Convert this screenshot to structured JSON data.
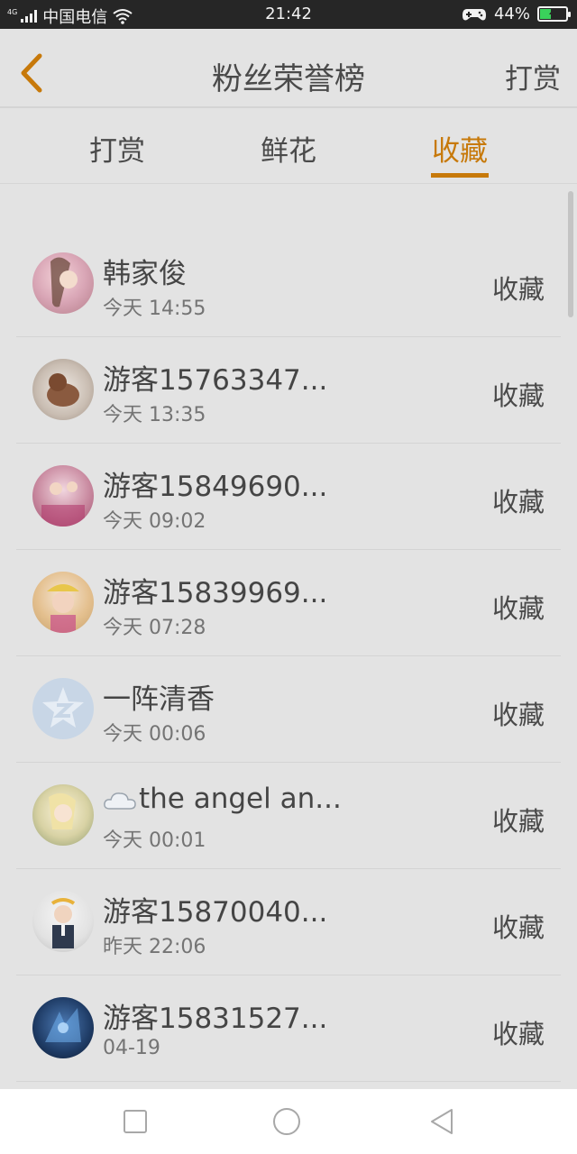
{
  "status_bar": {
    "network_label": "4G",
    "carrier": "中国电信",
    "time": "21:42",
    "battery_pct": "44%",
    "battery_level": 0.44,
    "icons": [
      "signal-icon",
      "wifi-icon",
      "game-controller-icon",
      "battery-icon"
    ]
  },
  "header": {
    "title": "粉丝荣誉榜",
    "action_label": "打赏",
    "back_icon": "chevron-left-icon",
    "accent_color": "#c7790a"
  },
  "tabs": [
    {
      "label": "打赏",
      "active": false
    },
    {
      "label": "鲜花",
      "active": false
    },
    {
      "label": "收藏",
      "active": true
    }
  ],
  "list": [
    {
      "name": "韩家俊",
      "time": "今天 14:55",
      "action": "收藏"
    },
    {
      "name": "游客15763347...",
      "time": "今天 13:35",
      "action": "收藏"
    },
    {
      "name": "游客15849690...",
      "time": "今天 09:02",
      "action": "收藏"
    },
    {
      "name": "游客15839969...",
      "time": "今天 07:28",
      "action": "收藏"
    },
    {
      "name": "一阵清香",
      "time": "今天 00:06",
      "action": "收藏"
    },
    {
      "name": "the angel an...",
      "time": "今天 00:01",
      "action": "收藏"
    },
    {
      "name": "游客15870040...",
      "time": "昨天 22:06",
      "action": "收藏"
    },
    {
      "name": "游客15831527...",
      "time": "04-19",
      "action": "收藏"
    }
  ],
  "nav_bar": {
    "icons": [
      "square-recents-icon",
      "circle-home-icon",
      "triangle-back-icon"
    ]
  }
}
